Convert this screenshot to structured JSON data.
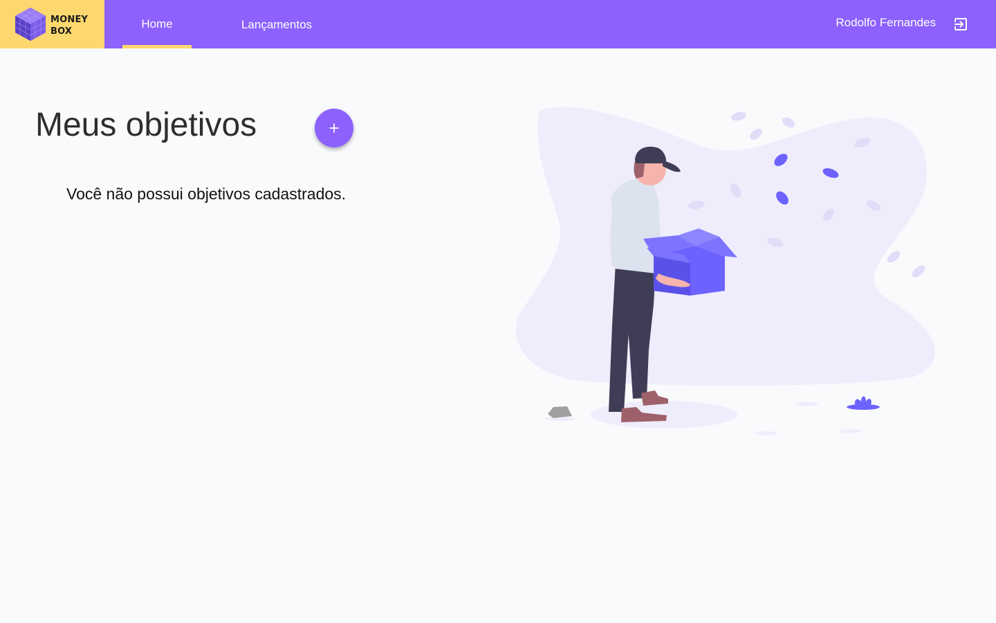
{
  "brand": {
    "line1": "MONEY",
    "line2": "BOX"
  },
  "nav": {
    "items": [
      {
        "label": "Home",
        "active": true
      },
      {
        "label": "Lançamentos",
        "active": false
      }
    ]
  },
  "user": {
    "name": "Rodolfo Fernandes",
    "logout_icon": "logout-icon"
  },
  "main": {
    "title": "Meus objetivos",
    "add_button_icon": "plus-icon",
    "empty_message": "Você não possui objetivos cadastrados."
  },
  "colors": {
    "primary": "#8c61fd",
    "accent": "#fdd86e",
    "background": "#f9fafc",
    "illustration_bg": "#efedfc"
  }
}
